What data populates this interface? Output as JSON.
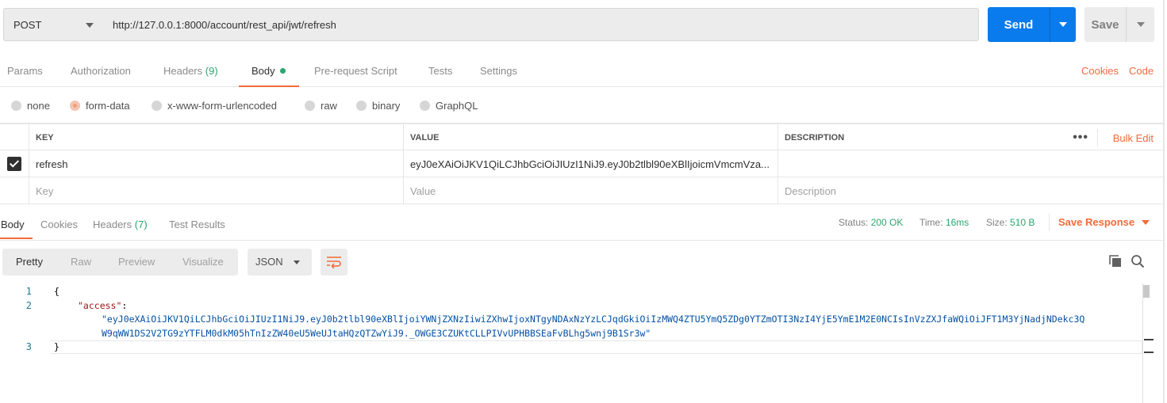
{
  "request": {
    "method": "POST",
    "url": "http://127.0.0.1:8000/account/rest_api/jwt/refresh",
    "send_label": "Send",
    "save_label": "Save"
  },
  "request_tabs": {
    "params": "Params",
    "authorization": "Authorization",
    "headers": "Headers",
    "headers_count": "(9)",
    "body": "Body",
    "prerequest": "Pre-request Script",
    "tests": "Tests",
    "settings": "Settings",
    "cookies": "Cookies",
    "code": "Code"
  },
  "body_types": {
    "none": "none",
    "form_data": "form-data",
    "urlencoded": "x-www-form-urlencoded",
    "raw": "raw",
    "binary": "binary",
    "graphql": "GraphQL",
    "selected": "form-data"
  },
  "kv_table": {
    "headers": {
      "key": "KEY",
      "value": "VALUE",
      "description": "DESCRIPTION"
    },
    "more": "•••",
    "bulk_edit": "Bulk Edit",
    "rows": [
      {
        "checked": true,
        "key": "refresh",
        "value": "eyJ0eXAiOiJKV1QiLCJhbGciOiJIUzI1NiJ9.eyJ0b2tlbl90eXBlIjoicmVmcmVza...",
        "description": ""
      }
    ],
    "placeholders": {
      "key": "Key",
      "value": "Value",
      "description": "Description"
    }
  },
  "response_tabs": {
    "body": "Body",
    "cookies": "Cookies",
    "headers": "Headers",
    "headers_count": "(7)",
    "test_results": "Test Results"
  },
  "response_status": {
    "status_label": "Status:",
    "status_value": "200 OK",
    "time_label": "Time:",
    "time_value": "16ms",
    "size_label": "Size:",
    "size_value": "510 B",
    "save_response": "Save Response"
  },
  "view_modes": {
    "pretty": "Pretty",
    "raw": "Raw",
    "preview": "Preview",
    "visualize": "Visualize",
    "format": "JSON"
  },
  "response_body": {
    "line_numbers": [
      "1",
      "2",
      "3"
    ],
    "open_brace": "{",
    "key": "\"access\"",
    "colon": ":",
    "value_line1": "\"eyJ0eXAiOiJKV1QiLCJhbGciOiJIUzI1NiJ9.eyJ0b2tlbl90eXBlIjoiYWNjZXNzIiwiZXhwIjoxNTgyNDAxNzYzLCJqdGkiOiIzMWQ4ZTU5YmQ5ZDg0YTZmOTI3NzI4YjE5YmE1M2E0NCIsInVzZXJfaWQiOiJFT1M3YjNadjNDekc3Q",
    "value_line2": "W9qWW1DS2V2TG9zYTFLM0dkM05hTnIzZW40eU5WeUJtaHQzQTZwYiJ9._OWGE3CZUKtCLLPIVvUPHBBSEaFvBLhg5wnj9B1Sr3w\"",
    "close_brace": "}"
  },
  "colors": {
    "accent": "#f26b3a",
    "primary": "#097bed",
    "success": "#2aa56e"
  }
}
